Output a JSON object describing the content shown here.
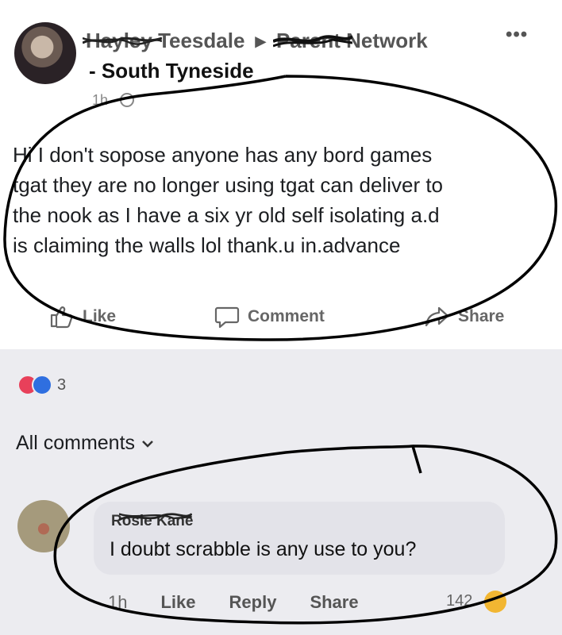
{
  "post": {
    "author": "Hayley Teesdale",
    "group": "Parent Network",
    "location": "- South Tyneside",
    "time": "1h ·",
    "more_icon": "more-dots-icon",
    "text": "Hi I don't sopose anyone has any bord games\ntgat they are no longer using tgat can deliver to\nthe nook as I have a six yr old self isolating a.d\nis claiming the walls lol  thank.u in.advance"
  },
  "actions": {
    "like": "Like",
    "comment": "Comment",
    "share": "Share"
  },
  "reactions": {
    "count": "3",
    "types": [
      "love",
      "like"
    ],
    "colors": {
      "love": "#e8405a",
      "like": "#2f6fe0"
    }
  },
  "all_comments": "All comments",
  "comment": {
    "author": "Rosie Kane",
    "text": "I doubt scrabble is any use to you?",
    "time": "1h",
    "like": "Like",
    "reply": "Reply",
    "share": "Share",
    "count": "142"
  },
  "colors": {
    "ink": "#000000",
    "bubble": "#e3e3e9"
  }
}
